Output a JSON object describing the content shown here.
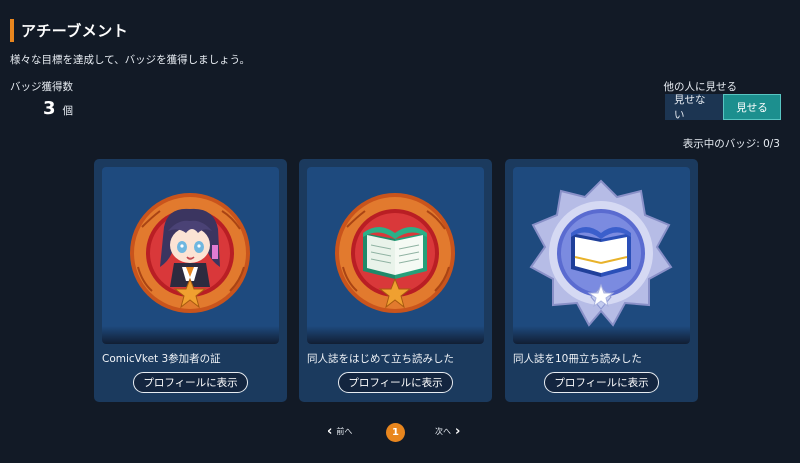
{
  "header": {
    "title": "アチーブメント",
    "subtitle": "様々な目標を達成して、バッジを獲得しましょう。"
  },
  "stats": {
    "badge_count_label": "バッジ獲得数",
    "badge_count": "3",
    "badge_count_unit": "個"
  },
  "visibility": {
    "label": "他の人に見せる",
    "hide_label": "見せない",
    "show_label": "見せる",
    "selected": "見せる"
  },
  "shown_badges": "表示中のバッジ: 0/3",
  "badges": [
    {
      "title": "ComicVket 3参加者の証",
      "button": "プロフィールに表示",
      "icon": "character-medal-icon"
    },
    {
      "title": "同人誌をはじめて立ち読みした",
      "button": "プロフィールに表示",
      "icon": "book-bronze-medal-icon"
    },
    {
      "title": "同人誌を10冊立ち読みした",
      "button": "プロフィールに表示",
      "icon": "book-silver-medal-icon"
    }
  ],
  "pagination": {
    "prev_label": "前へ",
    "next_label": "次へ",
    "current_page": "1"
  },
  "colors": {
    "background": "#121a26",
    "accent": "#e8861e",
    "card": "#1b3a5e",
    "toggle_active": "#1c8f8e"
  }
}
